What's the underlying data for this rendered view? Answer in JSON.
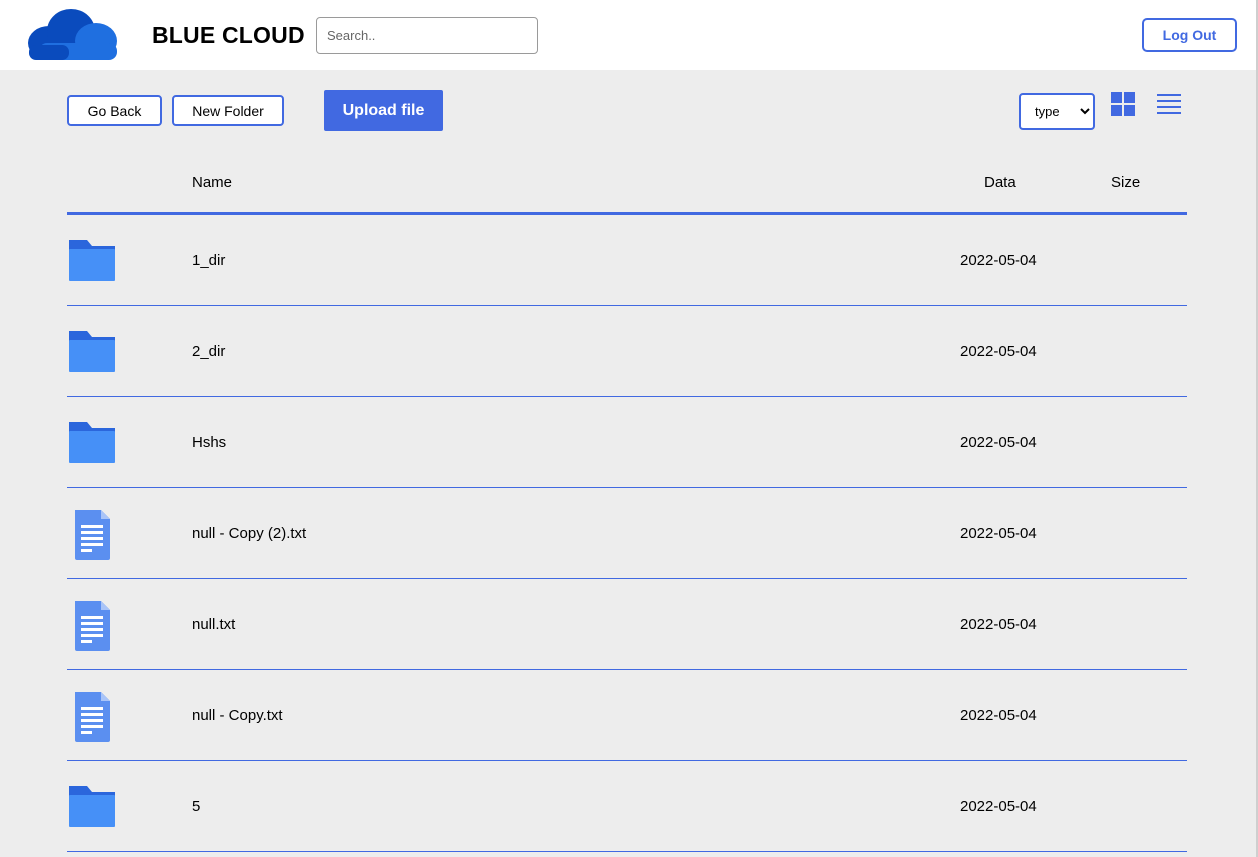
{
  "header": {
    "brand": "BLUE CLOUD",
    "search_placeholder": "Search..",
    "logout_label": "Log Out"
  },
  "toolbar": {
    "go_back_label": "Go Back",
    "new_folder_label": "New Folder",
    "upload_label": "Upload file",
    "sort_selected": "type",
    "grid_view_icon": "grid-icon",
    "list_view_icon": "list-icon"
  },
  "table": {
    "columns": [
      "Name",
      "Data",
      "Size"
    ],
    "rows": [
      {
        "type": "folder",
        "icon": "folder-icon",
        "name": "1_dir",
        "date": "2022-05-04",
        "size": ""
      },
      {
        "type": "folder",
        "icon": "folder-icon",
        "name": "2_dir",
        "date": "2022-05-04",
        "size": ""
      },
      {
        "type": "folder",
        "icon": "folder-icon",
        "name": "Hshs",
        "date": "2022-05-04",
        "size": ""
      },
      {
        "type": "file",
        "icon": "document-icon",
        "name": "null - Copy (2).txt",
        "date": "2022-05-04",
        "size": ""
      },
      {
        "type": "file",
        "icon": "document-icon",
        "name": "null.txt",
        "date": "2022-05-04",
        "size": ""
      },
      {
        "type": "file",
        "icon": "document-icon",
        "name": "null - Copy.txt",
        "date": "2022-05-04",
        "size": ""
      },
      {
        "type": "folder",
        "icon": "folder-icon",
        "name": "5",
        "date": "2022-05-04",
        "size": ""
      }
    ]
  },
  "colors": {
    "accent": "#4169e1",
    "background": "#ededed",
    "logo_dark": "#0a4bbd",
    "logo_light": "#1f6fe0",
    "folder_back": "#2b66dc",
    "folder_front": "#4690f7",
    "document": "#5b8ff0"
  }
}
